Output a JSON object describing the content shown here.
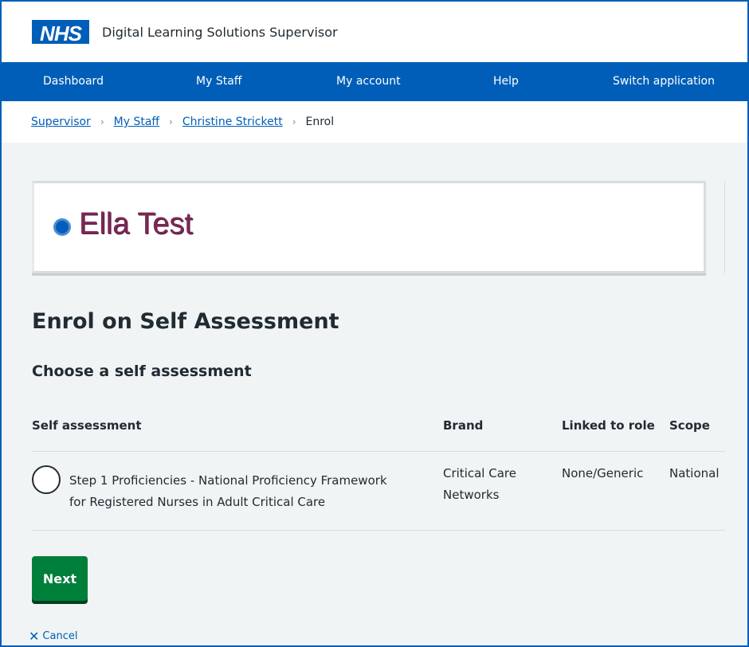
{
  "header": {
    "logo": "NHS",
    "service_name": "Digital Learning Solutions Supervisor"
  },
  "nav": {
    "items": [
      {
        "label": "Dashboard"
      },
      {
        "label": "My Staff"
      },
      {
        "label": "My account"
      },
      {
        "label": "Help"
      },
      {
        "label": "Switch application"
      }
    ]
  },
  "breadcrumb": {
    "items": [
      {
        "label": "Supervisor"
      },
      {
        "label": "My Staff"
      },
      {
        "label": "Christine Strickett"
      }
    ],
    "separator": "›",
    "current": "Enrol"
  },
  "name_card": {
    "name": "Ella Test"
  },
  "main": {
    "title": "Enrol on Self Assessment",
    "subtitle": "Choose a self assessment",
    "table": {
      "columns": [
        "Self assessment",
        "Brand",
        "Linked to role",
        "Scope"
      ],
      "rows": [
        {
          "self_assessment_line1": "Step 1 Proficiencies - National Proficiency Framework",
          "self_assessment_line2": "for Registered Nurses in Adult Critical Care",
          "brand_line1": "Critical Care",
          "brand_line2": "Networks",
          "linked_to_role": "None/Generic",
          "scope": "National",
          "selected": false
        }
      ]
    },
    "next_label": "Next",
    "cancel_label": "Cancel",
    "cancel_icon": "✕"
  },
  "colors": {
    "nhs_blue": "#005eb8",
    "button_green": "#007f3b",
    "background": "#f0f4f5",
    "name_color": "#7c2855"
  }
}
